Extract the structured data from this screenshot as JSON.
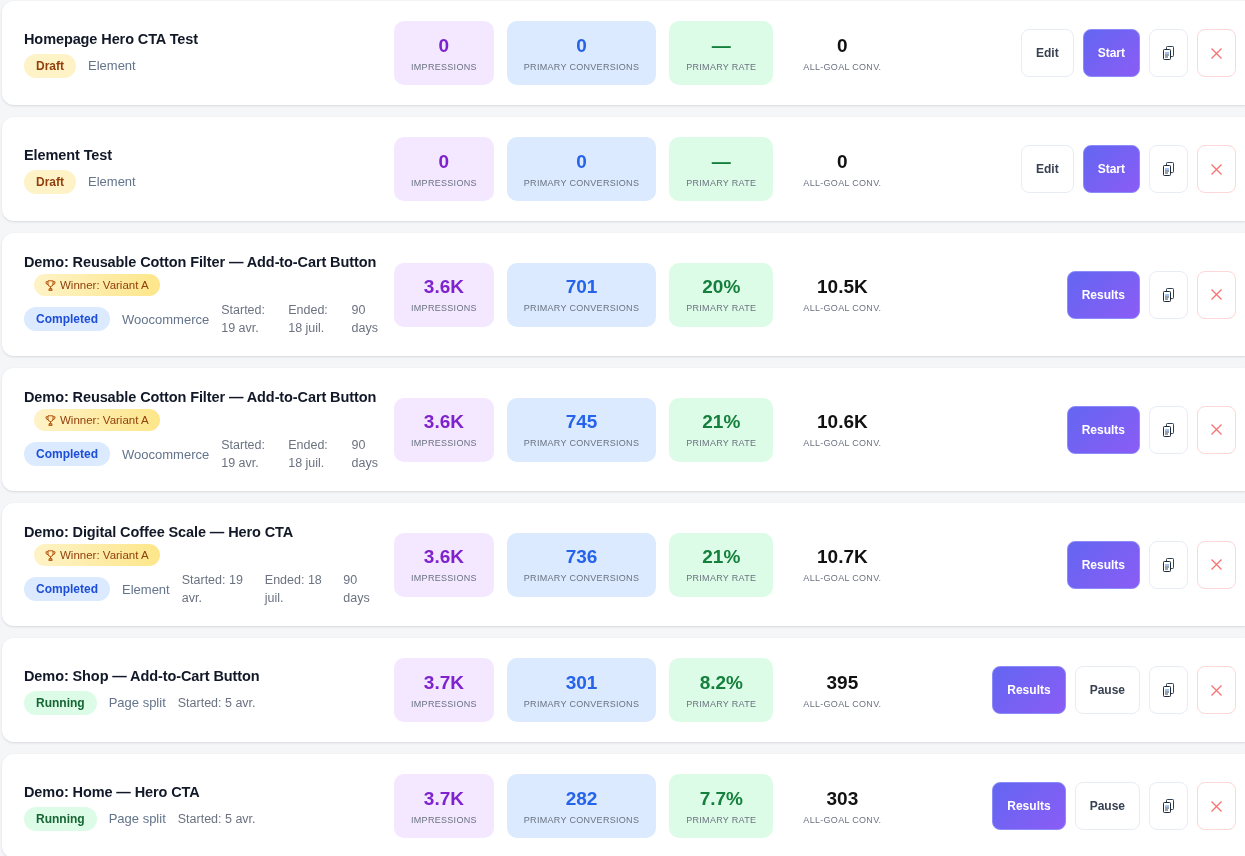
{
  "tests": [
    {
      "title": "Homepage Hero CTA Test",
      "status": {
        "kind": "draft",
        "label": "Draft"
      },
      "type": "Element",
      "stats": [
        {
          "kind": "impressions",
          "value": "0",
          "label": "IMPRESSIONS"
        },
        {
          "kind": "conversions",
          "value": "0",
          "label": "PRIMARY CONVERSIONS"
        },
        {
          "kind": "rate",
          "value": "—",
          "label": "PRIMARY RATE"
        },
        {
          "kind": "all_goal",
          "value": "0",
          "label": "ALL-GOAL CONV."
        }
      ],
      "actions": [
        {
          "kind": "secondary",
          "label": "Edit"
        },
        {
          "kind": "primary",
          "label": "Start"
        },
        {
          "kind": "copy"
        },
        {
          "kind": "delete"
        }
      ]
    },
    {
      "title": "Element Test",
      "status": {
        "kind": "draft",
        "label": "Draft"
      },
      "type": "Element",
      "stats": [
        {
          "kind": "impressions",
          "value": "0",
          "label": "IMPRESSIONS"
        },
        {
          "kind": "conversions",
          "value": "0",
          "label": "PRIMARY CONVERSIONS"
        },
        {
          "kind": "rate",
          "value": "—",
          "label": "PRIMARY RATE"
        },
        {
          "kind": "all_goal",
          "value": "0",
          "label": "ALL-GOAL CONV."
        }
      ],
      "actions": [
        {
          "kind": "secondary",
          "label": "Edit"
        },
        {
          "kind": "primary",
          "label": "Start"
        },
        {
          "kind": "copy"
        },
        {
          "kind": "delete"
        }
      ]
    },
    {
      "title": "Demo: Reusable Cotton Filter — Add-to-Cart Button",
      "winner": "Winner: Variant A",
      "status": {
        "kind": "completed",
        "label": "Completed"
      },
      "type": "Woocommerce",
      "dates": [
        "Started: 19 avr.",
        "Ended: 18 juil.",
        "90 days"
      ],
      "stats": [
        {
          "kind": "impressions",
          "value": "3.6K",
          "label": "IMPRESSIONS"
        },
        {
          "kind": "conversions",
          "value": "701",
          "label": "PRIMARY CONVERSIONS"
        },
        {
          "kind": "rate",
          "value": "20%",
          "label": "PRIMARY RATE"
        },
        {
          "kind": "all_goal",
          "value": "10.5K",
          "label": "ALL-GOAL CONV."
        }
      ],
      "actions": [
        {
          "kind": "primary",
          "label": "Results"
        },
        {
          "kind": "copy"
        },
        {
          "kind": "delete"
        }
      ]
    },
    {
      "title": "Demo: Reusable Cotton Filter — Add-to-Cart Button",
      "winner": "Winner: Variant A",
      "status": {
        "kind": "completed",
        "label": "Completed"
      },
      "type": "Woocommerce",
      "dates": [
        "Started: 19 avr.",
        "Ended: 18 juil.",
        "90 days"
      ],
      "stats": [
        {
          "kind": "impressions",
          "value": "3.6K",
          "label": "IMPRESSIONS"
        },
        {
          "kind": "conversions",
          "value": "745",
          "label": "PRIMARY CONVERSIONS"
        },
        {
          "kind": "rate",
          "value": "21%",
          "label": "PRIMARY RATE"
        },
        {
          "kind": "all_goal",
          "value": "10.6K",
          "label": "ALL-GOAL CONV."
        }
      ],
      "actions": [
        {
          "kind": "primary",
          "label": "Results"
        },
        {
          "kind": "copy"
        },
        {
          "kind": "delete"
        }
      ]
    },
    {
      "title": "Demo: Digital Coffee Scale — Hero CTA",
      "winner": "Winner: Variant A",
      "status": {
        "kind": "completed",
        "label": "Completed"
      },
      "type": "Element",
      "dates": [
        "Started: 19 avr.",
        "Ended: 18 juil.",
        "90 days"
      ],
      "stats": [
        {
          "kind": "impressions",
          "value": "3.6K",
          "label": "IMPRESSIONS"
        },
        {
          "kind": "conversions",
          "value": "736",
          "label": "PRIMARY CONVERSIONS"
        },
        {
          "kind": "rate",
          "value": "21%",
          "label": "PRIMARY RATE"
        },
        {
          "kind": "all_goal",
          "value": "10.7K",
          "label": "ALL-GOAL CONV."
        }
      ],
      "actions": [
        {
          "kind": "primary",
          "label": "Results"
        },
        {
          "kind": "copy"
        },
        {
          "kind": "delete"
        }
      ]
    },
    {
      "title": "Demo: Shop — Add-to-Cart Button",
      "status": {
        "kind": "running",
        "label": "Running"
      },
      "type": "Page split",
      "dates": [
        "Started: 5 avr."
      ],
      "stats": [
        {
          "kind": "impressions",
          "value": "3.7K",
          "label": "IMPRESSIONS"
        },
        {
          "kind": "conversions",
          "value": "301",
          "label": "PRIMARY CONVERSIONS"
        },
        {
          "kind": "rate",
          "value": "8.2%",
          "label": "PRIMARY RATE"
        },
        {
          "kind": "all_goal",
          "value": "395",
          "label": "ALL-GOAL CONV."
        }
      ],
      "actions": [
        {
          "kind": "primary",
          "label": "Results"
        },
        {
          "kind": "secondary",
          "label": "Pause"
        },
        {
          "kind": "copy"
        },
        {
          "kind": "delete"
        }
      ]
    },
    {
      "title": "Demo: Home — Hero CTA",
      "status": {
        "kind": "running",
        "label": "Running"
      },
      "type": "Page split",
      "dates": [
        "Started: 5 avr."
      ],
      "stats": [
        {
          "kind": "impressions",
          "value": "3.7K",
          "label": "IMPRESSIONS"
        },
        {
          "kind": "conversions",
          "value": "282",
          "label": "PRIMARY CONVERSIONS"
        },
        {
          "kind": "rate",
          "value": "7.7%",
          "label": "PRIMARY RATE"
        },
        {
          "kind": "all_goal",
          "value": "303",
          "label": "ALL-GOAL CONV."
        }
      ],
      "actions": [
        {
          "kind": "primary",
          "label": "Results"
        },
        {
          "kind": "secondary",
          "label": "Pause"
        },
        {
          "kind": "copy"
        },
        {
          "kind": "delete"
        }
      ]
    }
  ]
}
